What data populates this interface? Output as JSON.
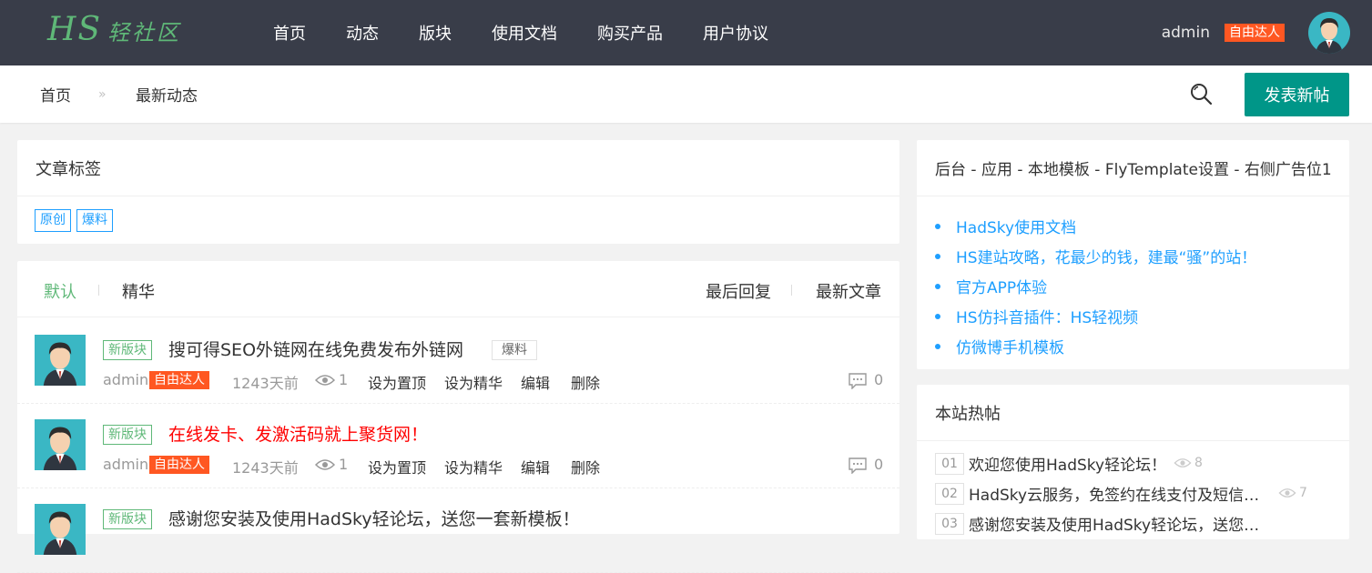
{
  "header": {
    "logo_latin": "HS",
    "logo_cn": "轻社区",
    "nav": [
      "首页",
      "动态",
      "版块",
      "使用文档",
      "购买产品",
      "用户协议"
    ],
    "username": "admin",
    "user_badge": "自由达人"
  },
  "breadcrumb": {
    "home": "首页",
    "separator": "»",
    "current": "最新动态"
  },
  "post_button": "发表新帖",
  "tags_panel": {
    "title": "文章标签",
    "tags": [
      "原创",
      "爆料"
    ]
  },
  "list": {
    "tabs_left": [
      "默认",
      "精华"
    ],
    "tabs_right": [
      "最后回复",
      "最新文章"
    ],
    "posts": [
      {
        "board": "新版块",
        "title": "搜可得SEO外链网在线免费发布外链网",
        "tag": "爆料",
        "author": "admin",
        "badge": "自由达人",
        "time": "1243天前",
        "views": "1",
        "act_top": "设为置顶",
        "act_essence": "设为精华",
        "act_edit": "编辑",
        "act_delete": "删除",
        "comments": "0"
      },
      {
        "board": "新版块",
        "title": "在线发卡、发激活码就上聚货网！",
        "author": "admin",
        "badge": "自由达人",
        "time": "1243天前",
        "views": "1",
        "act_top": "设为置顶",
        "act_essence": "设为精华",
        "act_edit": "编辑",
        "act_delete": "删除",
        "comments": "0"
      },
      {
        "board": "新版块",
        "title": "感谢您安装及使用HadSky轻论坛，送您一套新模板！"
      }
    ]
  },
  "side_ad": {
    "title": "后台 - 应用 - 本地模板 - FlyTemplate设置 - 右侧广告位1",
    "links": [
      "HadSky使用文档",
      "HS建站攻略，花最少的钱，建最“骚”的站！",
      "官方APP体验",
      "HS仿抖音插件：HS轻视频",
      "仿微博手机模板"
    ]
  },
  "side_hot": {
    "title": "本站热帖",
    "items": [
      {
        "num": "01",
        "title": "欢迎您使用HadSky轻论坛！",
        "views": "8"
      },
      {
        "num": "02",
        "title": "HadSky云服务，免签约在线支付及短信…",
        "views": "7"
      },
      {
        "num": "03",
        "title": "感谢您安装及使用HadSky轻论坛，送您…",
        "views": ""
      }
    ]
  },
  "colors": {
    "topbar": "#393d49",
    "accent": "#009688",
    "badge": "#ff5722",
    "link": "#1e9fff",
    "green": "#5fb878",
    "red_title": "#ff0000"
  }
}
